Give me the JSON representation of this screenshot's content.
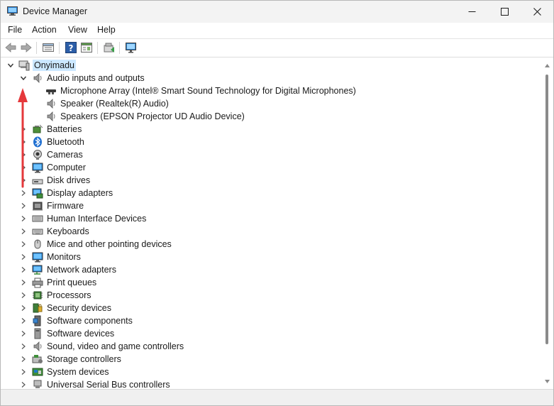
{
  "window": {
    "title": "Device Manager"
  },
  "menu": [
    "File",
    "Action",
    "View",
    "Help"
  ],
  "toolbar": [
    "back-arrow-icon",
    "forward-arrow-icon",
    "properties-icon",
    "help-icon",
    "view-list-icon",
    "update-driver-icon",
    "monitor-scan-icon"
  ],
  "tree": {
    "root": "Onyimadu",
    "items": [
      {
        "label": "Audio inputs and outputs",
        "icon": "audio-icon",
        "expanded": true,
        "children": [
          {
            "label": "Microphone Array (Intel® Smart Sound Technology for Digital Microphones)",
            "icon": "microphone-icon"
          },
          {
            "label": "Speaker (Realtek(R) Audio)",
            "icon": "speaker-icon"
          },
          {
            "label": "Speakers (EPSON Projector UD Audio Device)",
            "icon": "speaker-icon"
          }
        ]
      },
      {
        "label": "Batteries",
        "icon": "battery-icon"
      },
      {
        "label": "Bluetooth",
        "icon": "bluetooth-icon"
      },
      {
        "label": "Cameras",
        "icon": "camera-icon"
      },
      {
        "label": "Computer",
        "icon": "computer-icon"
      },
      {
        "label": "Disk drives",
        "icon": "disk-drive-icon"
      },
      {
        "label": "Display adapters",
        "icon": "display-adapter-icon"
      },
      {
        "label": "Firmware",
        "icon": "firmware-icon"
      },
      {
        "label": "Human Interface Devices",
        "icon": "hid-icon"
      },
      {
        "label": "Keyboards",
        "icon": "keyboard-icon"
      },
      {
        "label": "Mice and other pointing devices",
        "icon": "mouse-icon"
      },
      {
        "label": "Monitors",
        "icon": "monitor-icon"
      },
      {
        "label": "Network adapters",
        "icon": "network-adapter-icon"
      },
      {
        "label": "Print queues",
        "icon": "printer-icon"
      },
      {
        "label": "Processors",
        "icon": "processor-icon"
      },
      {
        "label": "Security devices",
        "icon": "security-device-icon"
      },
      {
        "label": "Software components",
        "icon": "software-component-icon"
      },
      {
        "label": "Software devices",
        "icon": "software-device-icon"
      },
      {
        "label": "Sound, video and game controllers",
        "icon": "sound-controller-icon"
      },
      {
        "label": "Storage controllers",
        "icon": "storage-controller-icon"
      },
      {
        "label": "System devices",
        "icon": "system-device-icon"
      },
      {
        "label": "Universal Serial Bus controllers",
        "icon": "usb-icon"
      }
    ]
  },
  "colors": {
    "selection": "#cce8ff",
    "annotation_arrow": "#e5383b",
    "accent": "#0078d4"
  }
}
